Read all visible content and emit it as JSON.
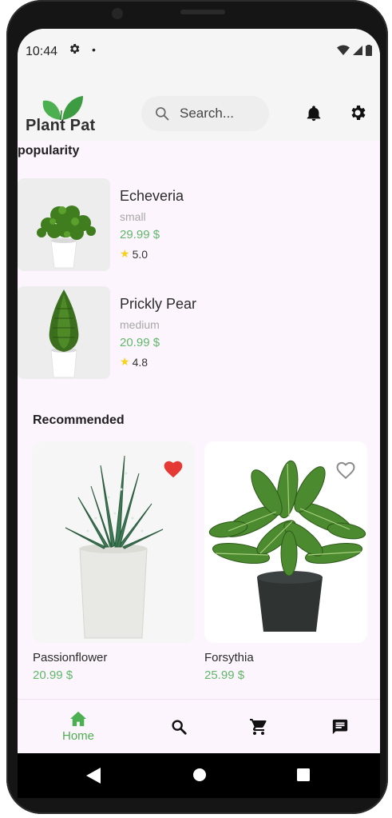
{
  "status_bar": {
    "time": "10:44"
  },
  "header": {
    "app_name": "Plant Pat",
    "search_placeholder": "Search..."
  },
  "popularity": {
    "title": "popularity",
    "items": [
      {
        "name": "Echeveria",
        "size": "small",
        "price": "29.99 $",
        "rating": "5.0"
      },
      {
        "name": "Prickly Pear",
        "size": "medium",
        "price": "20.99 $",
        "rating": "4.8"
      }
    ]
  },
  "recommended": {
    "title": "Recommended",
    "items": [
      {
        "name": "Passionflower",
        "price": "20.99 $",
        "favorited": true
      },
      {
        "name": "Forsythia",
        "price": "25.99 $",
        "favorited": false
      }
    ]
  },
  "bottom_nav": {
    "items": [
      {
        "label": "Home",
        "icon": "home-icon",
        "active": true
      },
      {
        "label": "",
        "icon": "search-icon",
        "active": false
      },
      {
        "label": "",
        "icon": "cart-icon",
        "active": false
      },
      {
        "label": "",
        "icon": "chat-icon",
        "active": false
      }
    ]
  },
  "colors": {
    "accent": "#4caf50",
    "price": "#5fb86a",
    "favorite": "#e53935",
    "star": "#f5d21c",
    "background": "#fdf5fd"
  }
}
